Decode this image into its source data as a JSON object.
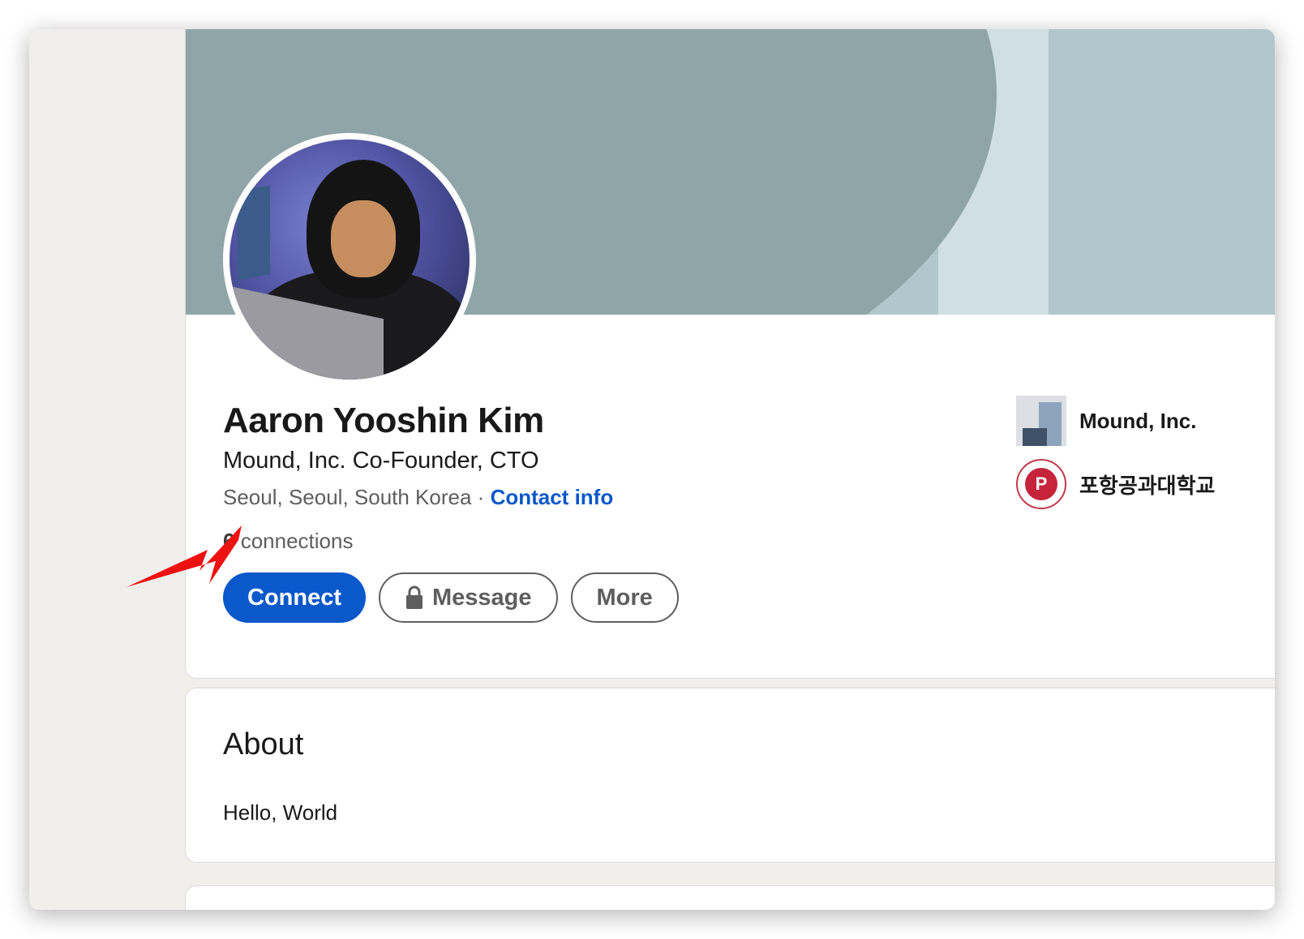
{
  "profile": {
    "name": "Aaron Yooshin Kim",
    "headline": "Mound, Inc. Co-Founder, CTO",
    "location": "Seoul, Seoul, South Korea",
    "separator": " · ",
    "contact_label": "Contact info",
    "connections_count": "6",
    "connections_label": " connections"
  },
  "actions": {
    "connect_label": "Connect",
    "message_label": "Message",
    "more_label": "More"
  },
  "sidebar": {
    "items": [
      {
        "label": "Mound, Inc.",
        "icon": "company-logo-icon"
      },
      {
        "label": "포항공과대학교",
        "icon": "university-seal-icon"
      }
    ]
  },
  "about": {
    "title": "About",
    "text": "Hello, World"
  },
  "colors": {
    "primary": "#0a58ca",
    "banner": "#8fa5a7",
    "annotation_arrow": "#ee1111"
  }
}
